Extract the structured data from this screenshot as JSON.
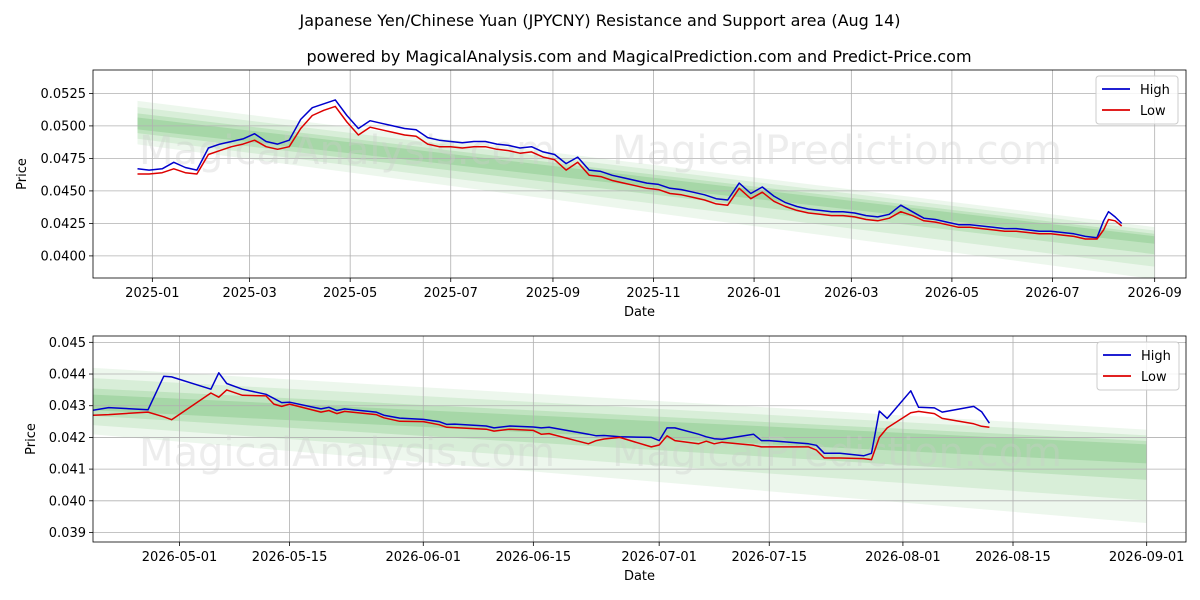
{
  "title": "Japanese Yen/Chinese Yuan (JPYCNY) Resistance and Support area (Aug 14)",
  "subtitle": "powered by MagicalAnalysis.com and MagicalPrediction.com and Predict-Price.com",
  "watermarks": [
    "MagicalAnalysis.com",
    "MagicalPrediction.com"
  ],
  "colors": {
    "high": "#0000cc",
    "low": "#dd0000",
    "band": "#4caf50",
    "grid": "#b0b0b0"
  },
  "legend": {
    "position": "top-right",
    "high": "High",
    "low": "Low"
  },
  "chart_data": [
    {
      "type": "line",
      "panel": "top",
      "xlabel": "Date",
      "ylabel": "Price",
      "grid": true,
      "xlim": [
        "2024-11-26",
        "2026-09-20"
      ],
      "ylim": [
        0.0383,
        0.0543
      ],
      "xticks": [
        "2025-01",
        "2025-03",
        "2025-05",
        "2025-07",
        "2025-09",
        "2025-11",
        "2026-01",
        "2026-03",
        "2026-05",
        "2026-07",
        "2026-09"
      ],
      "yticks": [
        "0.0400",
        "0.0425",
        "0.0450",
        "0.0475",
        "0.0500",
        "0.0525"
      ],
      "series": [
        {
          "name": "High",
          "color": "#0000cc",
          "x": [
            "2024-12-23",
            "2024-12-30",
            "2025-01-07",
            "2025-01-14",
            "2025-01-21",
            "2025-01-28",
            "2025-02-04",
            "2025-02-11",
            "2025-02-18",
            "2025-02-25",
            "2025-03-04",
            "2025-03-11",
            "2025-03-18",
            "2025-03-25",
            "2025-04-01",
            "2025-04-08",
            "2025-04-15",
            "2025-04-22",
            "2025-04-29",
            "2025-05-06",
            "2025-05-13",
            "2025-05-20",
            "2025-05-27",
            "2025-06-03",
            "2025-06-10",
            "2025-06-17",
            "2025-06-24",
            "2025-07-01",
            "2025-07-08",
            "2025-07-15",
            "2025-07-22",
            "2025-07-29",
            "2025-08-05",
            "2025-08-12",
            "2025-08-19",
            "2025-08-26",
            "2025-09-02",
            "2025-09-09",
            "2025-09-16",
            "2025-09-23",
            "2025-09-30",
            "2025-10-07",
            "2025-10-14",
            "2025-10-21",
            "2025-10-28",
            "2025-11-04",
            "2025-11-11",
            "2025-11-18",
            "2025-11-25",
            "2025-12-02",
            "2025-12-09",
            "2025-12-16",
            "2025-12-23",
            "2025-12-30",
            "2026-01-06",
            "2026-01-13",
            "2026-01-20",
            "2026-01-27",
            "2026-02-03",
            "2026-02-10",
            "2026-02-17",
            "2026-02-24",
            "2026-03-03",
            "2026-03-10",
            "2026-03-17",
            "2026-03-24",
            "2026-03-31",
            "2026-04-07",
            "2026-04-14",
            "2026-04-21",
            "2026-04-28",
            "2026-05-05",
            "2026-05-12",
            "2026-05-19",
            "2026-05-26",
            "2026-06-02",
            "2026-06-09",
            "2026-06-16",
            "2026-06-23",
            "2026-06-30",
            "2026-07-07",
            "2026-07-14",
            "2026-07-21",
            "2026-07-28",
            "2026-08-01",
            "2026-08-04",
            "2026-08-08",
            "2026-08-12"
          ],
          "y": [
            0.0467,
            0.0466,
            0.0467,
            0.0472,
            0.0468,
            0.0466,
            0.0483,
            0.0486,
            0.0488,
            0.049,
            0.0494,
            0.0488,
            0.0486,
            0.0489,
            0.0505,
            0.0514,
            0.0517,
            0.052,
            0.0508,
            0.0498,
            0.0504,
            0.0502,
            0.05,
            0.0498,
            0.0497,
            0.0491,
            0.0489,
            0.0488,
            0.0487,
            0.0488,
            0.0488,
            0.0486,
            0.0485,
            0.0483,
            0.0484,
            0.048,
            0.0478,
            0.0471,
            0.0476,
            0.0466,
            0.0465,
            0.0462,
            0.046,
            0.0458,
            0.0456,
            0.0455,
            0.0452,
            0.0451,
            0.0449,
            0.0447,
            0.0444,
            0.0443,
            0.0456,
            0.0448,
            0.0453,
            0.0446,
            0.0441,
            0.0438,
            0.0436,
            0.0435,
            0.0434,
            0.0434,
            0.0433,
            0.0431,
            0.043,
            0.0432,
            0.0439,
            0.0434,
            0.0429,
            0.0428,
            0.0426,
            0.0424,
            0.0424,
            0.0423,
            0.0422,
            0.0421,
            0.0421,
            0.042,
            0.0419,
            0.0419,
            0.0418,
            0.0417,
            0.0415,
            0.0414,
            0.0427,
            0.0434,
            0.043,
            0.0425
          ]
        },
        {
          "name": "Low",
          "color": "#dd0000",
          "x": [
            "2024-12-23",
            "2024-12-30",
            "2025-01-07",
            "2025-01-14",
            "2025-01-21",
            "2025-01-28",
            "2025-02-04",
            "2025-02-11",
            "2025-02-18",
            "2025-02-25",
            "2025-03-04",
            "2025-03-11",
            "2025-03-18",
            "2025-03-25",
            "2025-04-01",
            "2025-04-08",
            "2025-04-15",
            "2025-04-22",
            "2025-04-29",
            "2025-05-06",
            "2025-05-13",
            "2025-05-20",
            "2025-05-27",
            "2025-06-03",
            "2025-06-10",
            "2025-06-17",
            "2025-06-24",
            "2025-07-01",
            "2025-07-08",
            "2025-07-15",
            "2025-07-22",
            "2025-07-29",
            "2025-08-05",
            "2025-08-12",
            "2025-08-19",
            "2025-08-26",
            "2025-09-02",
            "2025-09-09",
            "2025-09-16",
            "2025-09-23",
            "2025-09-30",
            "2025-10-07",
            "2025-10-14",
            "2025-10-21",
            "2025-10-28",
            "2025-11-04",
            "2025-11-11",
            "2025-11-18",
            "2025-11-25",
            "2025-12-02",
            "2025-12-09",
            "2025-12-16",
            "2025-12-23",
            "2025-12-30",
            "2026-01-06",
            "2026-01-13",
            "2026-01-20",
            "2026-01-27",
            "2026-02-03",
            "2026-02-10",
            "2026-02-17",
            "2026-02-24",
            "2026-03-03",
            "2026-03-10",
            "2026-03-17",
            "2026-03-24",
            "2026-03-31",
            "2026-04-07",
            "2026-04-14",
            "2026-04-21",
            "2026-04-28",
            "2026-05-05",
            "2026-05-12",
            "2026-05-19",
            "2026-05-26",
            "2026-06-02",
            "2026-06-09",
            "2026-06-16",
            "2026-06-23",
            "2026-06-30",
            "2026-07-07",
            "2026-07-14",
            "2026-07-21",
            "2026-07-28",
            "2026-08-01",
            "2026-08-04",
            "2026-08-08",
            "2026-08-12"
          ],
          "y": [
            0.0463,
            0.0463,
            0.0464,
            0.0467,
            0.0464,
            0.0463,
            0.0478,
            0.0481,
            0.0484,
            0.0486,
            0.0489,
            0.0484,
            0.0482,
            0.0484,
            0.0498,
            0.0508,
            0.0512,
            0.0515,
            0.0503,
            0.0493,
            0.0499,
            0.0497,
            0.0495,
            0.0493,
            0.0492,
            0.0486,
            0.0484,
            0.0484,
            0.0483,
            0.0484,
            0.0484,
            0.0482,
            0.0481,
            0.0479,
            0.048,
            0.0476,
            0.0474,
            0.0466,
            0.0472,
            0.0462,
            0.0461,
            0.0458,
            0.0456,
            0.0454,
            0.0452,
            0.0451,
            0.0448,
            0.0447,
            0.0445,
            0.0443,
            0.044,
            0.0439,
            0.0452,
            0.0444,
            0.0449,
            0.0442,
            0.0438,
            0.0435,
            0.0433,
            0.0432,
            0.0431,
            0.0431,
            0.043,
            0.0428,
            0.0427,
            0.0429,
            0.0434,
            0.0431,
            0.0427,
            0.0426,
            0.0424,
            0.0422,
            0.0422,
            0.0421,
            0.042,
            0.0419,
            0.0419,
            0.0418,
            0.0417,
            0.0417,
            0.0416,
            0.0415,
            0.0413,
            0.0413,
            0.042,
            0.0428,
            0.0427,
            0.0423
          ]
        }
      ]
    },
    {
      "type": "line",
      "panel": "bottom",
      "xlabel": "Date",
      "ylabel": "Price",
      "grid": true,
      "xlim": [
        "2026-04-20",
        "2026-09-06"
      ],
      "ylim": [
        0.0387,
        0.0452
      ],
      "xticks": [
        "2026-05-01",
        "2026-05-15",
        "2026-06-01",
        "2026-06-15",
        "2026-07-01",
        "2026-07-15",
        "2026-08-01",
        "2026-08-15",
        "2026-09-01"
      ],
      "yticks": [
        "0.039",
        "0.040",
        "0.041",
        "0.042",
        "0.043",
        "0.044",
        "0.045"
      ],
      "series": [
        {
          "name": "High",
          "color": "#0000cc",
          "x": [
            "2026-04-20",
            "2026-04-22",
            "2026-04-27",
            "2026-04-29",
            "2026-04-30",
            "2026-05-05",
            "2026-05-06",
            "2026-05-07",
            "2026-05-09",
            "2026-05-12",
            "2026-05-13",
            "2026-05-14",
            "2026-05-15",
            "2026-05-19",
            "2026-05-20",
            "2026-05-21",
            "2026-05-22",
            "2026-05-26",
            "2026-05-27",
            "2026-05-29",
            "2026-06-01",
            "2026-06-03",
            "2026-06-04",
            "2026-06-05",
            "2026-06-09",
            "2026-06-10",
            "2026-06-12",
            "2026-06-15",
            "2026-06-16",
            "2026-06-17",
            "2026-06-22",
            "2026-06-23",
            "2026-06-24",
            "2026-06-26",
            "2026-06-30",
            "2026-07-01",
            "2026-07-02",
            "2026-07-03",
            "2026-07-06",
            "2026-07-07",
            "2026-07-08",
            "2026-07-09",
            "2026-07-13",
            "2026-07-14",
            "2026-07-15",
            "2026-07-20",
            "2026-07-21",
            "2026-07-22",
            "2026-07-24",
            "2026-07-27",
            "2026-07-28",
            "2026-07-29",
            "2026-07-30",
            "2026-08-02",
            "2026-08-03",
            "2026-08-05",
            "2026-08-06",
            "2026-08-10",
            "2026-08-11",
            "2026-08-12"
          ],
          "y": [
            0.04286,
            0.04294,
            0.04287,
            0.04393,
            0.04391,
            0.04352,
            0.04404,
            0.0437,
            0.04352,
            0.04336,
            0.04323,
            0.0431,
            0.04311,
            0.0429,
            0.04295,
            0.04285,
            0.0429,
            0.0428,
            0.0427,
            0.04261,
            0.04257,
            0.0425,
            0.04241,
            0.04242,
            0.04236,
            0.0423,
            0.04236,
            0.04233,
            0.0423,
            0.04232,
            0.0421,
            0.04205,
            0.04206,
            0.04202,
            0.042,
            0.0419,
            0.0423,
            0.0423,
            0.0421,
            0.04202,
            0.04196,
            0.04194,
            0.0421,
            0.0419,
            0.0419,
            0.0418,
            0.04175,
            0.0415,
            0.0415,
            0.04142,
            0.0415,
            0.04283,
            0.0426,
            0.04347,
            0.04295,
            0.04293,
            0.0428,
            0.04298,
            0.04281,
            0.04245
          ]
        },
        {
          "name": "Low",
          "color": "#dd0000",
          "x": [
            "2026-04-20",
            "2026-04-22",
            "2026-04-27",
            "2026-04-29",
            "2026-04-30",
            "2026-05-05",
            "2026-05-06",
            "2026-05-07",
            "2026-05-09",
            "2026-05-12",
            "2026-05-13",
            "2026-05-14",
            "2026-05-15",
            "2026-05-19",
            "2026-05-20",
            "2026-05-21",
            "2026-05-22",
            "2026-05-26",
            "2026-05-27",
            "2026-05-29",
            "2026-06-01",
            "2026-06-03",
            "2026-06-04",
            "2026-06-05",
            "2026-06-09",
            "2026-06-10",
            "2026-06-12",
            "2026-06-15",
            "2026-06-16",
            "2026-06-17",
            "2026-06-22",
            "2026-06-23",
            "2026-06-24",
            "2026-06-26",
            "2026-06-30",
            "2026-07-01",
            "2026-07-02",
            "2026-07-03",
            "2026-07-06",
            "2026-07-07",
            "2026-07-08",
            "2026-07-09",
            "2026-07-13",
            "2026-07-14",
            "2026-07-15",
            "2026-07-20",
            "2026-07-21",
            "2026-07-22",
            "2026-07-24",
            "2026-07-27",
            "2026-07-28",
            "2026-07-29",
            "2026-07-30",
            "2026-08-02",
            "2026-08-03",
            "2026-08-05",
            "2026-08-06",
            "2026-08-10",
            "2026-08-11",
            "2026-08-12"
          ],
          "y": [
            0.0427,
            0.04272,
            0.0428,
            0.04265,
            0.04256,
            0.0434,
            0.04327,
            0.0435,
            0.04333,
            0.04331,
            0.04305,
            0.04298,
            0.04305,
            0.0428,
            0.04285,
            0.04275,
            0.04282,
            0.04272,
            0.04262,
            0.04251,
            0.0425,
            0.0424,
            0.04232,
            0.04231,
            0.04226,
            0.0422,
            0.04226,
            0.04222,
            0.0421,
            0.04212,
            0.0418,
            0.0419,
            0.04195,
            0.042,
            0.0417,
            0.04176,
            0.04205,
            0.0419,
            0.0418,
            0.04188,
            0.0418,
            0.04185,
            0.04175,
            0.0417,
            0.0417,
            0.0417,
            0.0416,
            0.04135,
            0.04135,
            0.04133,
            0.0413,
            0.042,
            0.0423,
            0.04278,
            0.04282,
            0.04275,
            0.0426,
            0.04243,
            0.04235,
            0.04232
          ]
        }
      ]
    }
  ]
}
